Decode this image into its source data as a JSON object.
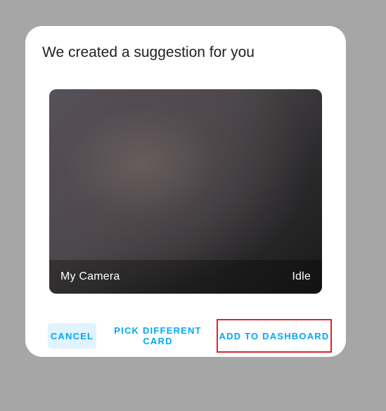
{
  "dialog": {
    "title": "We created a suggestion for you"
  },
  "camera_card": {
    "name": "My Camera",
    "state": "Idle"
  },
  "actions": {
    "cancel_label": "CANCEL",
    "pick_label": "PICK DIFFERENT CARD",
    "add_label": "ADD TO DASHBOARD"
  },
  "colors": {
    "backdrop": "#a6a6a6",
    "accent": "#03a9f4",
    "highlight_border": "#e0212d"
  }
}
